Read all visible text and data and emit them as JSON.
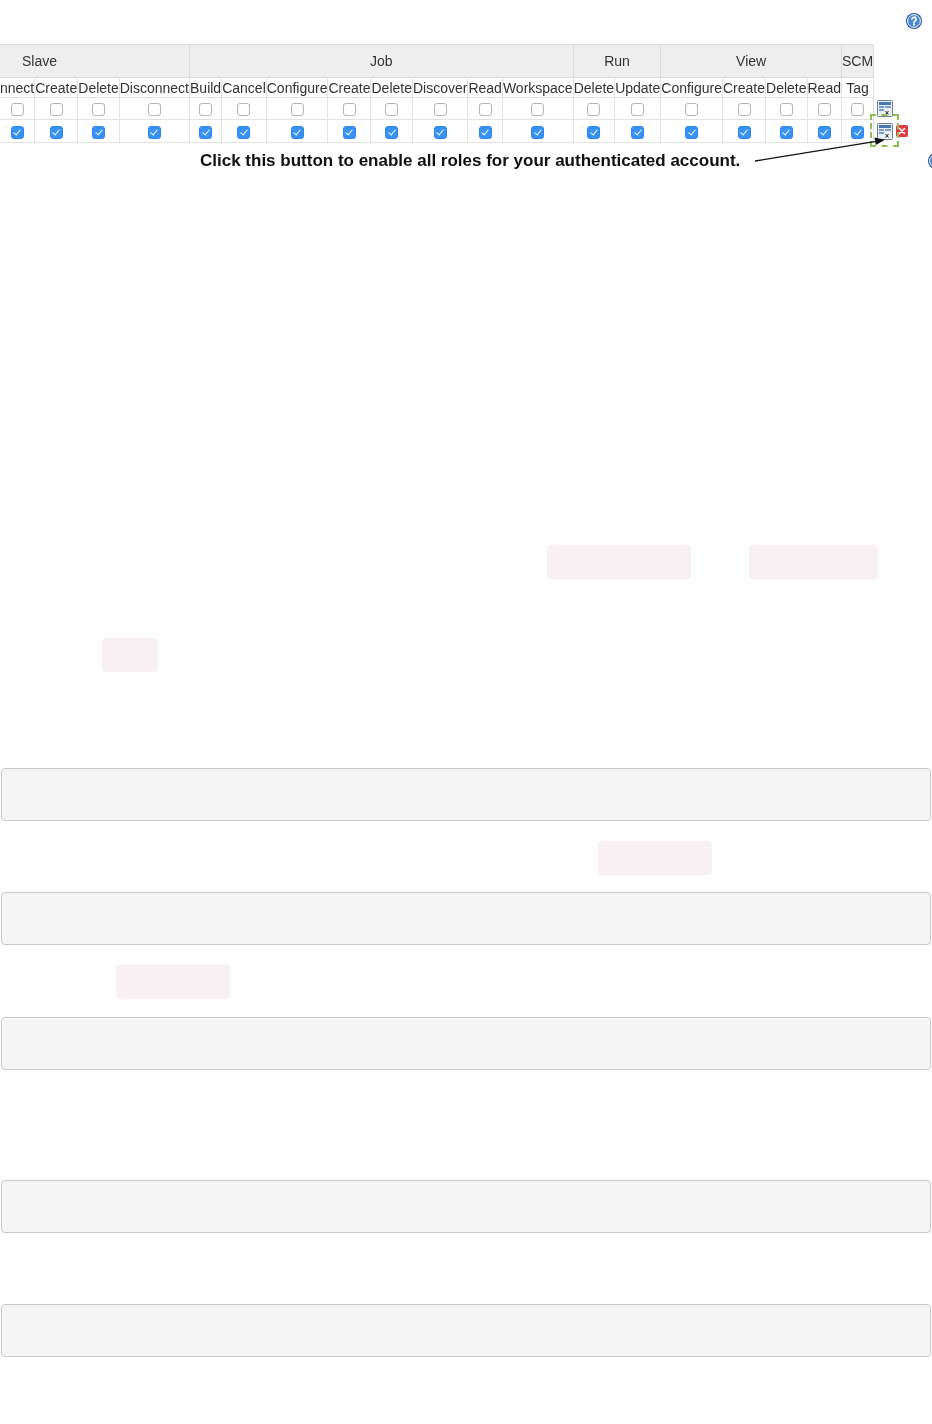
{
  "table": {
    "groups": [
      {
        "label": "Slave",
        "columns": [
          "nnect",
          "Create",
          "Delete",
          "Disconnect"
        ]
      },
      {
        "label": "Job",
        "columns": [
          "Build",
          "Cancel",
          "Configure",
          "Create",
          "Delete",
          "Discover",
          "Read",
          "Workspace"
        ]
      },
      {
        "label": "Run",
        "columns": [
          "Delete",
          "Update"
        ]
      },
      {
        "label": "View",
        "columns": [
          "Configure",
          "Create",
          "Delete",
          "Read"
        ]
      },
      {
        "label": "SCM",
        "columns": [
          "Tag"
        ]
      }
    ],
    "rows": [
      {
        "checks": [
          {
            "checked": false
          },
          {
            "checked": false
          },
          {
            "checked": false
          },
          {
            "checked": false
          },
          {
            "checked": false
          },
          {
            "checked": false
          },
          {
            "checked": false
          },
          {
            "checked": false
          },
          {
            "checked": false
          },
          {
            "checked": false
          },
          {
            "checked": false
          },
          {
            "checked": false
          },
          {
            "checked": false
          },
          {
            "checked": false
          },
          {
            "checked": false
          },
          {
            "checked": false
          },
          {
            "checked": false
          },
          {
            "checked": false
          },
          {
            "checked": false
          }
        ],
        "deletable": false,
        "highlighted": false
      },
      {
        "checks": [
          {
            "checked": true
          },
          {
            "checked": true
          },
          {
            "checked": true
          },
          {
            "checked": true
          },
          {
            "checked": true
          },
          {
            "checked": true
          },
          {
            "checked": true
          },
          {
            "checked": true
          },
          {
            "checked": true
          },
          {
            "checked": true
          },
          {
            "checked": true
          },
          {
            "checked": true
          },
          {
            "checked": true
          },
          {
            "checked": true
          },
          {
            "checked": true
          },
          {
            "checked": true
          },
          {
            "checked": true
          },
          {
            "checked": true
          },
          {
            "checked": true
          }
        ],
        "deletable": true,
        "highlighted": true
      }
    ]
  },
  "annotation": {
    "text": "Click this button to enable all roles for your authenticated account."
  },
  "document": {
    "blocks": [
      {
        "kind": "code_span"
      },
      {
        "kind": "code_span"
      },
      {
        "kind": "code_span"
      },
      {
        "kind": "code_block"
      },
      {
        "kind": "code_span"
      },
      {
        "kind": "code_block"
      },
      {
        "kind": "code_span"
      },
      {
        "kind": "code_block"
      },
      {
        "kind": "code_block"
      },
      {
        "kind": "code_block"
      }
    ]
  }
}
